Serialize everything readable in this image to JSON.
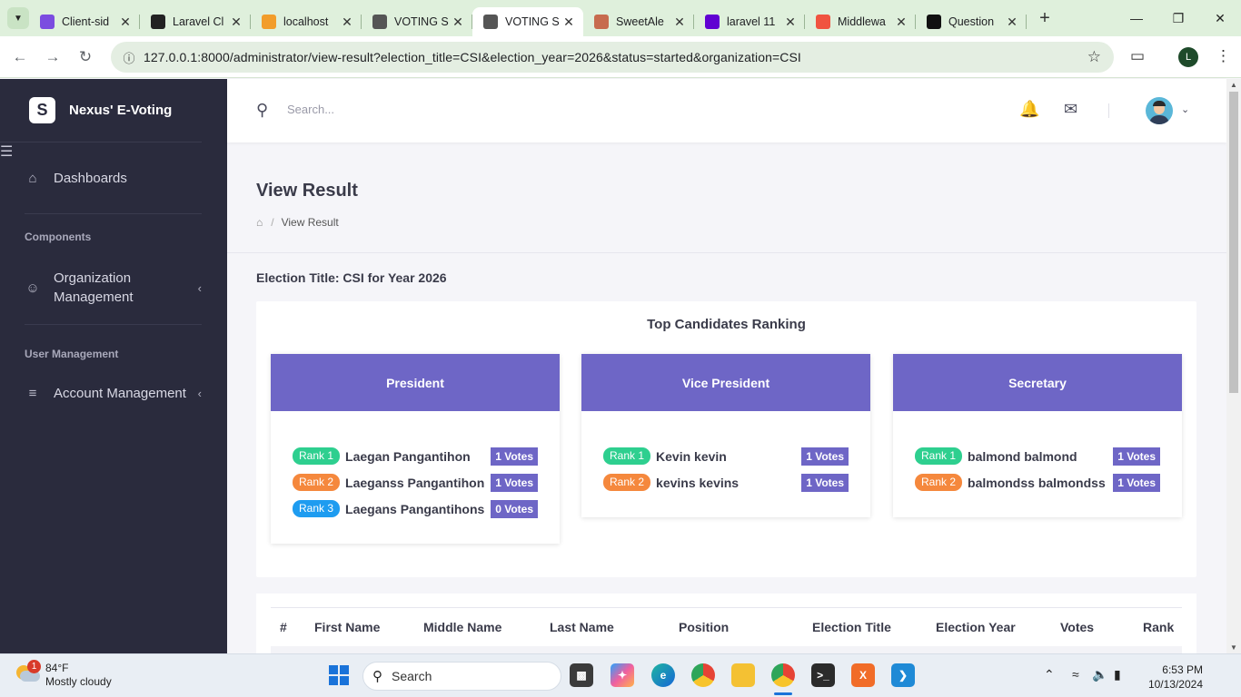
{
  "browser": {
    "tabs": [
      {
        "title": "Client-sid",
        "icon": "double-chevron-icon",
        "color": "#7b4ce0"
      },
      {
        "title": "Laravel Cl",
        "icon": "openai-icon",
        "color": "#222222"
      },
      {
        "title": "localhost",
        "icon": "phpmyadmin-icon",
        "color": "#f29d2b"
      },
      {
        "title": "VOTING S",
        "icon": "voting-icon",
        "color": "#555555"
      },
      {
        "title": "VOTING S",
        "icon": "voting-icon",
        "color": "#555555",
        "active": true
      },
      {
        "title": "SweetAle",
        "icon": "sweetalert-icon",
        "color": "#c76b4e"
      },
      {
        "title": "laravel 11",
        "icon": "yahoo-icon",
        "color": "#6001d2"
      },
      {
        "title": "Middlewa",
        "icon": "laravel-icon",
        "color": "#f05340"
      },
      {
        "title": "Question",
        "icon": "question-icon",
        "color": "#111111"
      }
    ],
    "url_host": "127.0.0.1",
    "url_rest": ":8000/administrator/view-result?election_title=CSI&election_year=2026&status=started&organization=CSI",
    "profile_initial": "L"
  },
  "sidebar": {
    "brand": "Nexus' E-Voting",
    "dashboards": "Dashboards",
    "components_section": "Components",
    "org_management": "Organization Management",
    "user_section": "User Management",
    "account_management": "Account Management"
  },
  "topbar": {
    "search_placeholder": "Search..."
  },
  "page": {
    "title": "View Result",
    "breadcrumb_current": "View Result",
    "election_title": "Election Title: CSI for Year 2026",
    "ranking_title": "Top Candidates Ranking"
  },
  "positions": [
    {
      "name": "President",
      "candidates": [
        {
          "rank": "Rank 1",
          "name": "Laegan Pangantihon",
          "votes": "1 Votes"
        },
        {
          "rank": "Rank 2",
          "name": "Laeganss Pangantihon",
          "votes": "1 Votes"
        },
        {
          "rank": "Rank 3",
          "name": "Laegans Pangantihons",
          "votes": "0 Votes"
        }
      ]
    },
    {
      "name": "Vice President",
      "candidates": [
        {
          "rank": "Rank 1",
          "name": "Kevin kevin",
          "votes": "1 Votes"
        },
        {
          "rank": "Rank 2",
          "name": "kevins kevins",
          "votes": "1 Votes"
        }
      ]
    },
    {
      "name": "Secretary",
      "candidates": [
        {
          "rank": "Rank 1",
          "name": "balmond balmond",
          "votes": "1 Votes"
        },
        {
          "rank": "Rank 2",
          "name": "balmondss balmondss",
          "votes": "1 Votes"
        }
      ]
    }
  ],
  "rank_colors": {
    "1": "#2ecf8f",
    "2": "#f5883d",
    "3": "#1e9cf0"
  },
  "accent": "#6e66c6",
  "table": {
    "headers": [
      "#",
      "First Name",
      "Middle Name",
      "Last Name",
      "Position",
      "Election Title",
      "Election Year",
      "Votes",
      "Rank"
    ]
  },
  "taskbar": {
    "temp": "84°F",
    "weather": "Mostly cloudy",
    "weather_badge": "1",
    "search": "Search",
    "time": "6:53 PM",
    "date": "10/13/2024"
  }
}
